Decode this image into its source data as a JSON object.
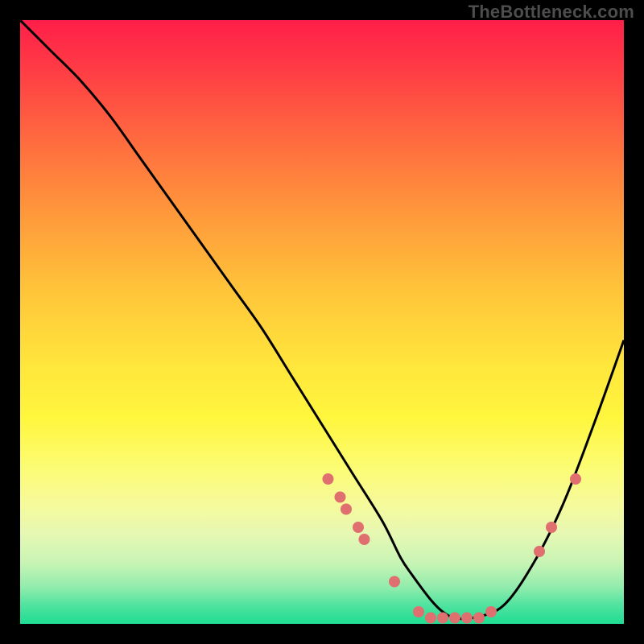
{
  "watermark": "TheBottleneck.com",
  "colors": {
    "background": "#000000",
    "curve_stroke": "#000000",
    "marker": "#e07070",
    "gradient_top": "#ff1f49",
    "gradient_bottom": "#1fdc92"
  },
  "chart_data": {
    "type": "line",
    "title": "",
    "xlabel": "",
    "ylabel": "",
    "xlim": [
      0,
      100
    ],
    "ylim": [
      0,
      100
    ],
    "grid": false,
    "legend": false,
    "annotations": [
      "TheBottleneck.com"
    ],
    "series": [
      {
        "name": "bottleneck-curve",
        "x": [
          0,
          5,
          10,
          15,
          20,
          25,
          30,
          35,
          40,
          45,
          50,
          55,
          60,
          63,
          65,
          68,
          70,
          72,
          75,
          80,
          85,
          90,
          95,
          100
        ],
        "values": [
          100,
          95,
          90,
          84,
          77,
          70,
          63,
          56,
          49,
          41,
          33,
          25,
          17,
          11,
          8,
          4,
          2,
          1,
          1,
          3,
          10,
          20,
          33,
          47
        ]
      }
    ],
    "markers": [
      {
        "name": "dot-left-1",
        "x": 51,
        "y": 24
      },
      {
        "name": "dot-left-2",
        "x": 53,
        "y": 21
      },
      {
        "name": "dot-left-3",
        "x": 54,
        "y": 19
      },
      {
        "name": "dot-left-4",
        "x": 56,
        "y": 16
      },
      {
        "name": "dot-left-5",
        "x": 57,
        "y": 14
      },
      {
        "name": "dot-left-6",
        "x": 62,
        "y": 7
      },
      {
        "name": "dot-bottom-1",
        "x": 66,
        "y": 2
      },
      {
        "name": "dot-bottom-2",
        "x": 68,
        "y": 1
      },
      {
        "name": "dot-bottom-3",
        "x": 70,
        "y": 1
      },
      {
        "name": "dot-bottom-4",
        "x": 72,
        "y": 1
      },
      {
        "name": "dot-bottom-5",
        "x": 74,
        "y": 1
      },
      {
        "name": "dot-bottom-6",
        "x": 76,
        "y": 1
      },
      {
        "name": "dot-bottom-7",
        "x": 78,
        "y": 2
      },
      {
        "name": "dot-right-1",
        "x": 86,
        "y": 12
      },
      {
        "name": "dot-right-2",
        "x": 88,
        "y": 16
      },
      {
        "name": "dot-right-3",
        "x": 92,
        "y": 24
      }
    ]
  }
}
